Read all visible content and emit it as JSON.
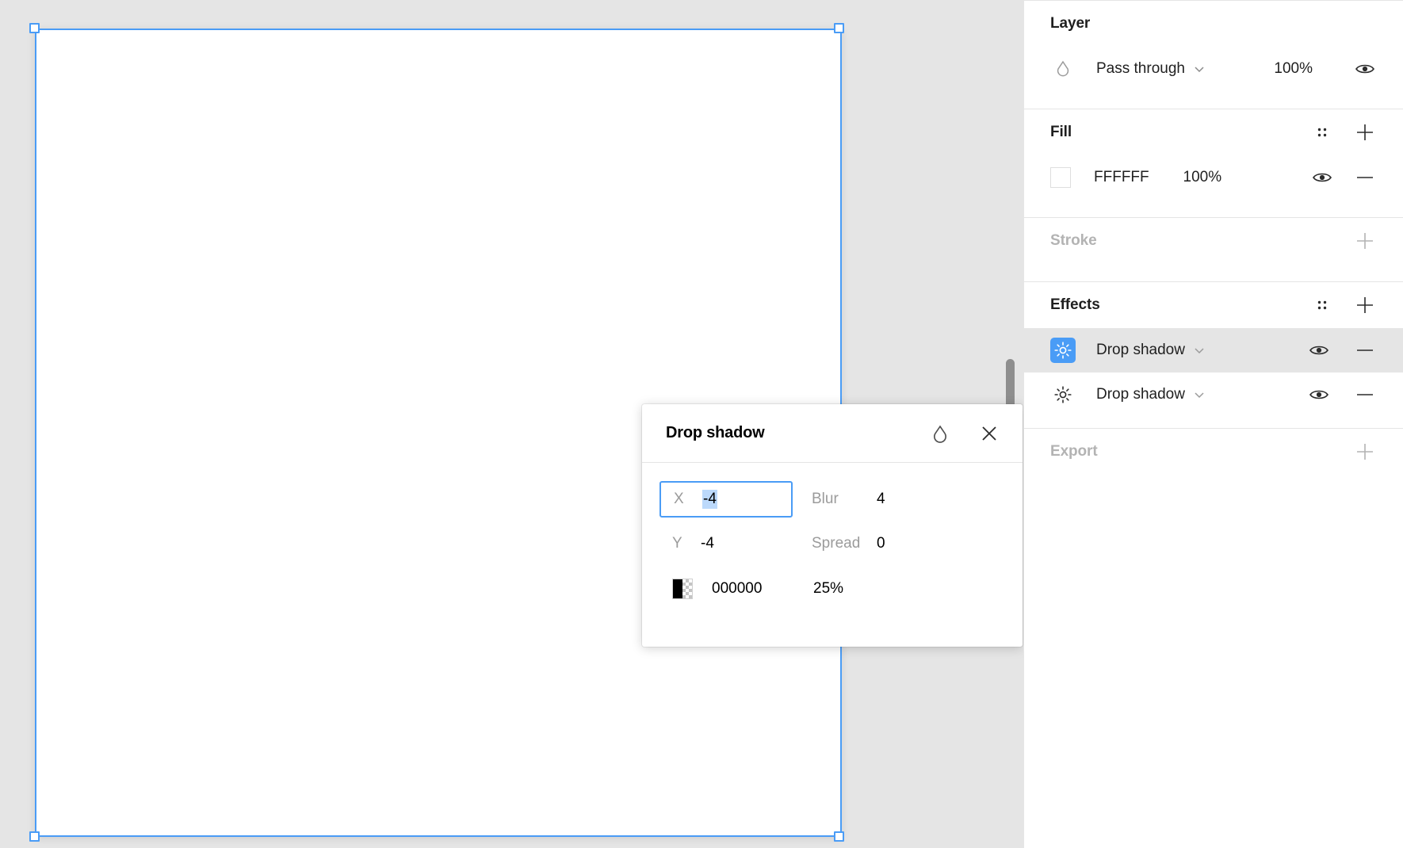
{
  "canvas": {
    "background_color": "#E5E5E5",
    "artboard_fill": "#FFFFFF",
    "selection_color": "#4A9CF6",
    "selection_handles": [
      "top-left",
      "top-right",
      "bottom-left",
      "bottom-right"
    ]
  },
  "popover": {
    "title": "Drop shadow",
    "blend_icon": "droplet-icon",
    "close_icon": "close-icon",
    "fields": {
      "x": {
        "label": "X",
        "value": "-4",
        "focused": true,
        "text_selected": true
      },
      "y": {
        "label": "Y",
        "value": "-4",
        "focused": false,
        "text_selected": false
      },
      "blur": {
        "label": "Blur",
        "value": "4"
      },
      "spread": {
        "label": "Spread",
        "value": "0"
      }
    },
    "color": {
      "swatch_color": "#000000",
      "hex": "000000",
      "opacity": "25%"
    }
  },
  "panel": {
    "layer": {
      "title": "Layer",
      "blend_icon": "blend-mode-icon",
      "blend_mode": "Pass through",
      "opacity": "100%",
      "visibility_icon": "eye-icon",
      "chevron_icon": "chevron-down-icon"
    },
    "fill": {
      "title": "Fill",
      "style_icon": "styles-icon",
      "add_icon": "plus-icon",
      "items": [
        {
          "swatch_color": "#FFFFFF",
          "hex": "FFFFFF",
          "opacity": "100%",
          "visibility_icon": "eye-icon",
          "remove_icon": "minus-icon"
        }
      ]
    },
    "stroke": {
      "title": "Stroke",
      "muted": true,
      "add_icon": "plus-icon"
    },
    "effects": {
      "title": "Effects",
      "style_icon": "styles-icon",
      "add_icon": "plus-icon",
      "items": [
        {
          "icon": "drop-shadow-icon",
          "label": "Drop shadow",
          "selected": true,
          "chevron_icon": "chevron-down-icon",
          "visibility_icon": "eye-icon",
          "remove_icon": "minus-icon"
        },
        {
          "icon": "drop-shadow-icon",
          "label": "Drop shadow",
          "selected": false,
          "chevron_icon": "chevron-down-icon",
          "visibility_icon": "eye-icon",
          "remove_icon": "minus-icon"
        }
      ]
    },
    "export": {
      "title": "Export",
      "muted": true,
      "add_icon": "plus-icon"
    }
  }
}
